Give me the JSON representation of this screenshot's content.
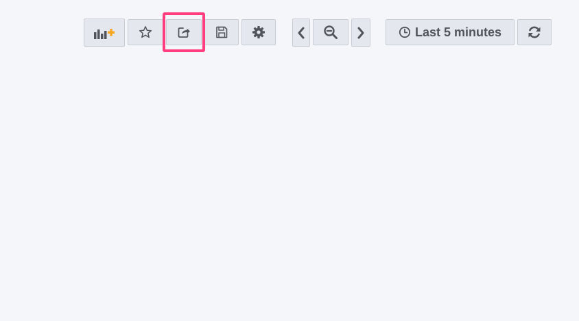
{
  "toolbar": {
    "buttons": [
      {
        "name": "add-panel-button",
        "icon": "bar-chart-plus-icon"
      },
      {
        "name": "star-button",
        "icon": "star-icon"
      },
      {
        "name": "share-button",
        "icon": "share-icon",
        "highlighted": true
      },
      {
        "name": "save-button",
        "icon": "save-icon"
      },
      {
        "name": "settings-button",
        "icon": "gear-icon"
      }
    ],
    "time_controls": {
      "shift_back_icon": "chevron-left-icon",
      "zoom_out_icon": "zoom-out-icon",
      "shift_forward_icon": "chevron-right-icon",
      "time_range_label": "Last 5 minutes",
      "time_range_icon": "clock-icon",
      "refresh_icon": "refresh-icon"
    }
  },
  "colors": {
    "background": "#f5f6f9",
    "button_bg": "#e4e7ed",
    "button_border": "#c7ccd5",
    "icon": "#52545c",
    "accent_orange": "#f5a623",
    "highlight": "#ff3d7f"
  }
}
